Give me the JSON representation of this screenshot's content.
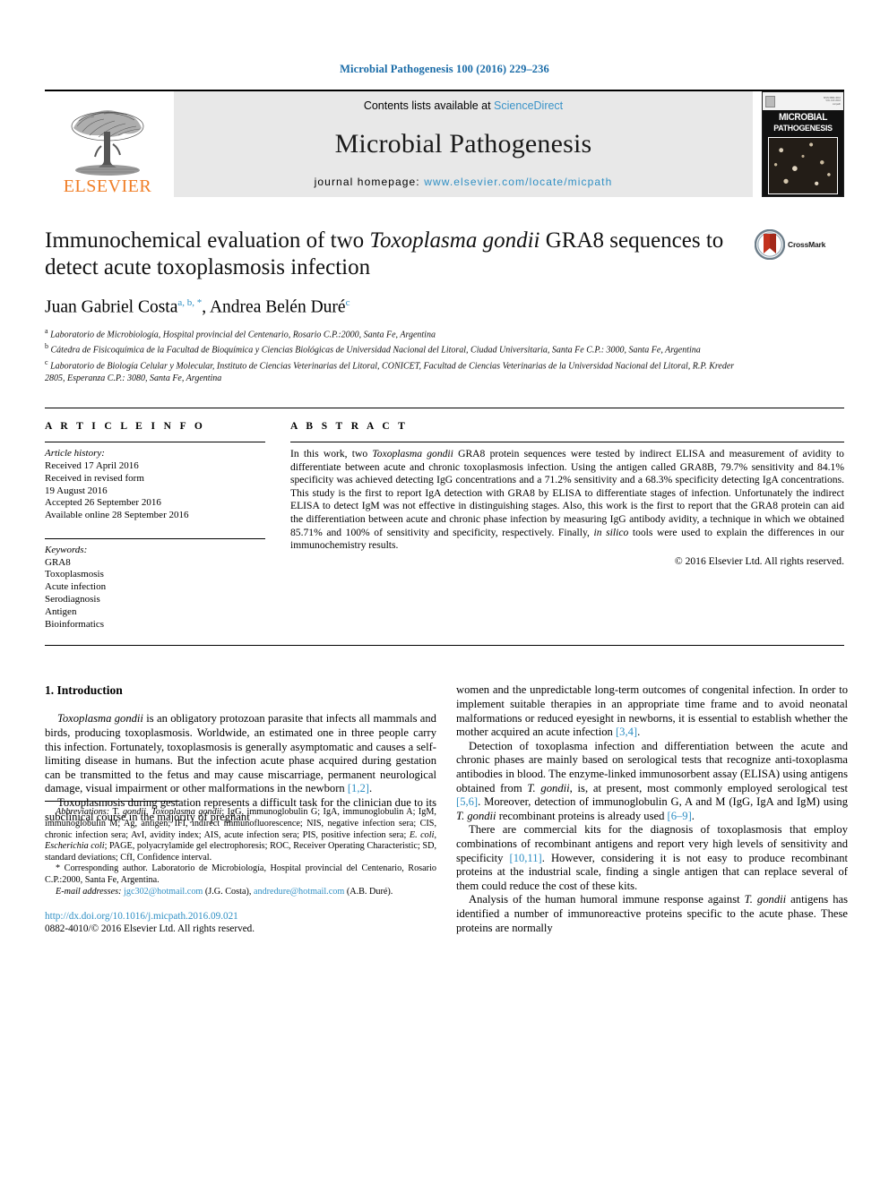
{
  "running_head": "Microbial Pathogenesis 100 (2016) 229–236",
  "header": {
    "publisher_name": "ELSEVIER",
    "contents_prefix": "Contents lists available at ",
    "contents_link": "ScienceDirect",
    "journal_title": "Microbial Pathogenesis",
    "homepage_prefix": "journal homepage: ",
    "homepage_url": "www.elsevier.com/locate/micpath",
    "cover_title_line1": "MICROBIAL",
    "cover_title_line2": "PATHOGENESIS"
  },
  "article": {
    "title_part1": "Immunochemical evaluation of two ",
    "title_italic": "Toxoplasma gondii",
    "title_part2": " GRA8 sequences to detect acute toxoplasmosis infection",
    "crossmark_label": "CrossMark",
    "authors_plain_1": "Juan Gabriel Costa",
    "authors_marks_1": "a, b, *",
    "authors_sep": ", ",
    "authors_plain_2": "Andrea Belén Duré",
    "authors_marks_2": "c",
    "affiliations": [
      {
        "mark": "a",
        "text": "Laboratorio de Microbiología, Hospital provincial del Centenario, Rosario C.P.:2000, Santa Fe, Argentina"
      },
      {
        "mark": "b",
        "text": "Cátedra de Fisicoquímica de la Facultad de Bioquímica y Ciencias Biológicas de Universidad Nacional del Litoral, Ciudad Universitaria, Santa Fe C.P.: 3000, Santa Fe, Argentina"
      },
      {
        "mark": "c",
        "text": "Laboratorio de Biología Celular y Molecular, Instituto de Ciencias Veterinarias del Litoral, CONICET, Facultad de Ciencias Veterinarias de la Universidad Nacional del Litoral, R.P. Kreder 2805, Esperanza C.P.: 3080, Santa Fe, Argentina"
      }
    ]
  },
  "article_info": {
    "heading": "A R T I C L E   I N F O",
    "history_label": "Article history:",
    "history_lines": [
      "Received 17 April 2016",
      "Received in revised form",
      "19 August 2016",
      "Accepted 26 September 2016",
      "Available online 28 September 2016"
    ],
    "keywords_label": "Keywords:",
    "keywords": [
      "GRA8",
      "Toxoplasmosis",
      "Acute infection",
      "Serodiagnosis",
      "Antigen",
      "Bioinformatics"
    ]
  },
  "abstract": {
    "heading": "A B S T R A C T",
    "segments": [
      {
        "t": "In this work, two ",
        "style": "normal"
      },
      {
        "t": "Toxoplasma gondii",
        "style": "italic"
      },
      {
        "t": " GRA8 protein sequences were tested by indirect ELISA and measurement of avidity to differentiate between acute and chronic toxoplasmosis infection. Using the antigen called GRA8B, 79.7% sensitivity and 84.1% specificity was achieved detecting IgG concentrations and a 71.2% sensitivity and a 68.3% specificity detecting IgA concentrations. This study is the first to report IgA detection with GRA8 by ELISA to differentiate stages of infection. Unfortunately the indirect ELISA to detect IgM was not effective in distinguishing stages. Also, this work is the first to report that the GRA8 protein can aid the differentiation between acute and chronic phase infection by measuring IgG antibody avidity, a technique in which we obtained 85.71% and 100% of sensitivity and specificity, respectively. Finally, ",
        "style": "normal"
      },
      {
        "t": "in silico",
        "style": "italic"
      },
      {
        "t": " tools were used to explain the differences in our immunochemistry results.",
        "style": "normal"
      }
    ],
    "copyright": "© 2016 Elsevier Ltd. All rights reserved."
  },
  "body": {
    "section_heading": "1. Introduction",
    "left_paragraphs": [
      {
        "segments": [
          {
            "t": "Toxoplasma gondii",
            "style": "italic"
          },
          {
            "t": " is an obligatory protozoan parasite that infects all mammals and birds, producing toxoplasmosis. Worldwide, an estimated one in three people carry this infection. Fortunately, toxoplasmosis is generally asymptomatic and causes a self-limiting disease in humans. But the infection acute phase acquired during gestation can be transmitted to the fetus and may cause miscarriage, permanent neurological damage, visual impairment or other malformations in the newborn ",
            "style": "normal"
          },
          {
            "t": "[1,2]",
            "style": "ref"
          },
          {
            "t": ".",
            "style": "normal"
          }
        ]
      },
      {
        "segments": [
          {
            "t": "Toxoplasmosis during gestation represents a difficult task for the clinician due to its subclinical course in the majority of pregnant",
            "style": "normal"
          }
        ]
      }
    ],
    "right_paragraphs": [
      {
        "indent": false,
        "segments": [
          {
            "t": "women and the unpredictable long-term outcomes of congenital infection. In order to implement suitable therapies in an appropriate time frame and to avoid neonatal malformations or reduced eyesight in newborns, it is essential to establish whether the mother acquired an acute infection ",
            "style": "normal"
          },
          {
            "t": "[3,4]",
            "style": "ref"
          },
          {
            "t": ".",
            "style": "normal"
          }
        ]
      },
      {
        "indent": true,
        "segments": [
          {
            "t": "Detection of toxoplasma infection and differentiation between the acute and chronic phases are mainly based on serological tests that recognize anti-toxoplasma antibodies in blood. The enzyme-linked immunosorbent assay (ELISA) using antigens obtained from ",
            "style": "normal"
          },
          {
            "t": "T. gondii",
            "style": "italic"
          },
          {
            "t": ", is, at present, most commonly employed serological test ",
            "style": "normal"
          },
          {
            "t": "[5,6]",
            "style": "ref"
          },
          {
            "t": ". Moreover, detection of immunoglobulin G, A and M (IgG, IgA and IgM) using ",
            "style": "normal"
          },
          {
            "t": "T. gondii",
            "style": "italic"
          },
          {
            "t": " recombinant proteins is already used ",
            "style": "normal"
          },
          {
            "t": "[6–9]",
            "style": "ref"
          },
          {
            "t": ".",
            "style": "normal"
          }
        ]
      },
      {
        "indent": true,
        "segments": [
          {
            "t": "There are commercial kits for the diagnosis of toxoplasmosis that employ combinations of recombinant antigens and report very high levels of sensitivity and specificity ",
            "style": "normal"
          },
          {
            "t": "[10,11]",
            "style": "ref"
          },
          {
            "t": ". However, considering it is not easy to produce recombinant proteins at the industrial scale, finding a single antigen that can replace several of them could reduce the cost of these kits.",
            "style": "normal"
          }
        ]
      },
      {
        "indent": true,
        "segments": [
          {
            "t": "Analysis of the human humoral immune response against ",
            "style": "normal"
          },
          {
            "t": "T. gondii",
            "style": "italic"
          },
          {
            "t": " antigens has identified a number of immunoreactive proteins specific to the acute phase. These proteins are normally",
            "style": "normal"
          }
        ]
      }
    ]
  },
  "footnotes": {
    "abbreviations": [
      {
        "t": "Abbreviations:",
        "style": "italic"
      },
      {
        "t": " T. ",
        "style": "normal"
      },
      {
        "t": "gondii",
        "style": "italic"
      },
      {
        "t": ", ",
        "style": "normal"
      },
      {
        "t": "Toxoplasma gondii",
        "style": "italic"
      },
      {
        "t": "; IgG, immunoglobulin G; IgA, immunoglobulin A; IgM, immunoglobulin M; Ag, antigen; IFI, indirect immunofluorescence; NIS, negative infection sera; CIS, chronic infection sera; AvI, avidity index; AIS, acute infection sera; PIS, positive infection sera; ",
        "style": "normal"
      },
      {
        "t": "E. coli",
        "style": "italic"
      },
      {
        "t": ", ",
        "style": "normal"
      },
      {
        "t": "Escherichia coli",
        "style": "italic"
      },
      {
        "t": "; PAGE, polyacrylamide gel electrophoresis; ROC, Receiver Operating Characteristic; SD, standard deviations; CfI, Confidence interval.",
        "style": "normal"
      }
    ],
    "corresponding": "* Corresponding author. Laboratorio de Microbiología, Hospital provincial del Centenario, Rosario C.P.:2000, Santa Fe, Argentina.",
    "email_label": "E-mail addresses:",
    "email_1": "jgc302@hotmail.com",
    "email_1_owner": " (J.G. Costa), ",
    "email_2": "andredure@hotmail.com",
    "email_2_owner": " (A.B. Duré).",
    "doi": "http://dx.doi.org/10.1016/j.micpath.2016.09.021",
    "issn": "0882-4010/© 2016 Elsevier Ltd. All rights reserved."
  },
  "colors": {
    "link_blue": "#2f8fc4",
    "header_blue": "#1a6ca8",
    "elsevier_orange": "#F07E26",
    "band_gray": "#e8e8e8"
  }
}
